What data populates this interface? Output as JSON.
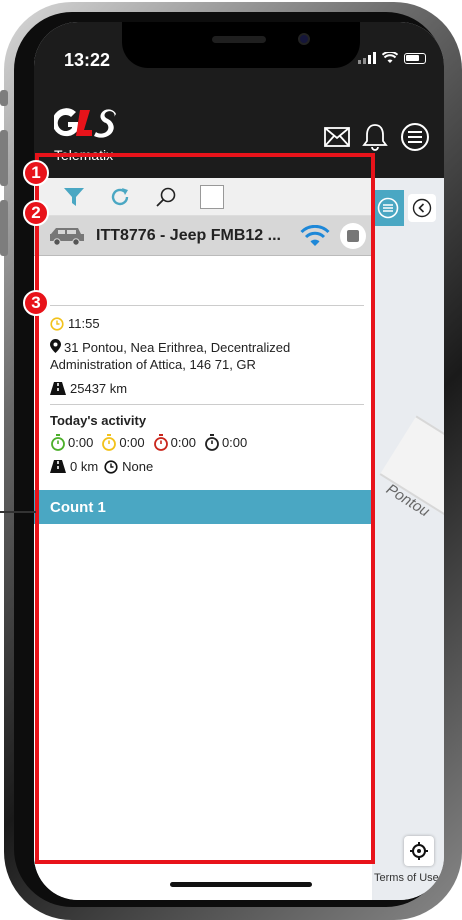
{
  "status_bar": {
    "time": "13:22"
  },
  "header": {
    "brand_sub": "Telematix"
  },
  "toolbar": {},
  "vehicle": {
    "name": "ITT8776 - Jeep FMB12 ..."
  },
  "info": {
    "time": "11:55",
    "address": "31 Pontou, Nea Erithrea, Decentralized Administration of Attica, 146 71, GR",
    "odometer": "25437 km"
  },
  "activity": {
    "title": "Today's activity",
    "timers": [
      {
        "value": "0:00",
        "color": "#4caf2a"
      },
      {
        "value": "0:00",
        "color": "#f2c21b"
      },
      {
        "value": "0:00",
        "color": "#c9261c"
      },
      {
        "value": "0:00",
        "color": "#222222"
      }
    ],
    "distance": "0 km",
    "duration": "None"
  },
  "group": {
    "label": "Count 1"
  },
  "map": {
    "street_label": "Pontou",
    "terms": "Terms of Use"
  },
  "annotations": [
    "1",
    "2",
    "3"
  ],
  "colors": {
    "accent": "#4aa7c3",
    "annotation": "#e8131a",
    "dark": "#1c1c1c"
  }
}
